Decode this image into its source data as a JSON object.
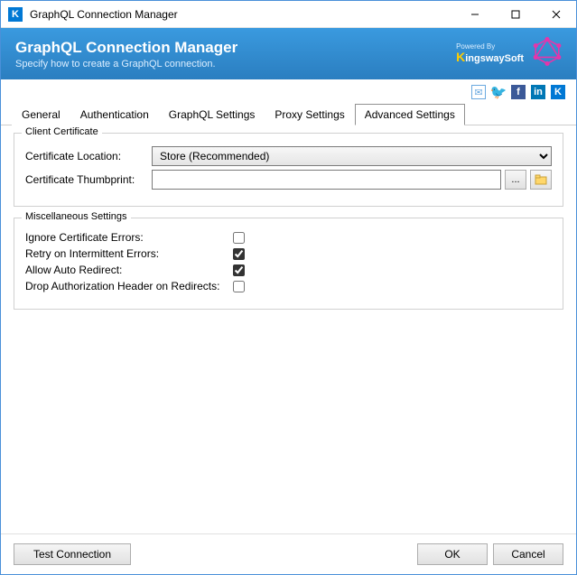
{
  "window": {
    "title": "GraphQL Connection Manager"
  },
  "header": {
    "title": "GraphQL Connection Manager",
    "subtitle": "Specify how to create a GraphQL connection.",
    "logo_powered": "Powered By",
    "logo_brand": "ingswaySoft"
  },
  "tabs": {
    "items": [
      {
        "label": "General"
      },
      {
        "label": "Authentication"
      },
      {
        "label": "GraphQL Settings"
      },
      {
        "label": "Proxy Settings"
      },
      {
        "label": "Advanced Settings"
      }
    ],
    "active_index": 4
  },
  "client_cert": {
    "legend": "Client Certificate",
    "location_label": "Certificate Location:",
    "location_value": "Store (Recommended)",
    "thumbprint_label": "Certificate Thumbprint:",
    "thumbprint_value": "",
    "browse_label": "..."
  },
  "misc": {
    "legend": "Miscellaneous Settings",
    "ignore_cert_label": "Ignore Certificate Errors:",
    "ignore_cert_checked": false,
    "retry_label": "Retry on Intermittent Errors:",
    "retry_checked": true,
    "redirect_label": "Allow Auto Redirect:",
    "redirect_checked": true,
    "drop_auth_label": "Drop Authorization Header on Redirects:",
    "drop_auth_checked": false
  },
  "footer": {
    "test_label": "Test Connection",
    "ok_label": "OK",
    "cancel_label": "Cancel"
  }
}
